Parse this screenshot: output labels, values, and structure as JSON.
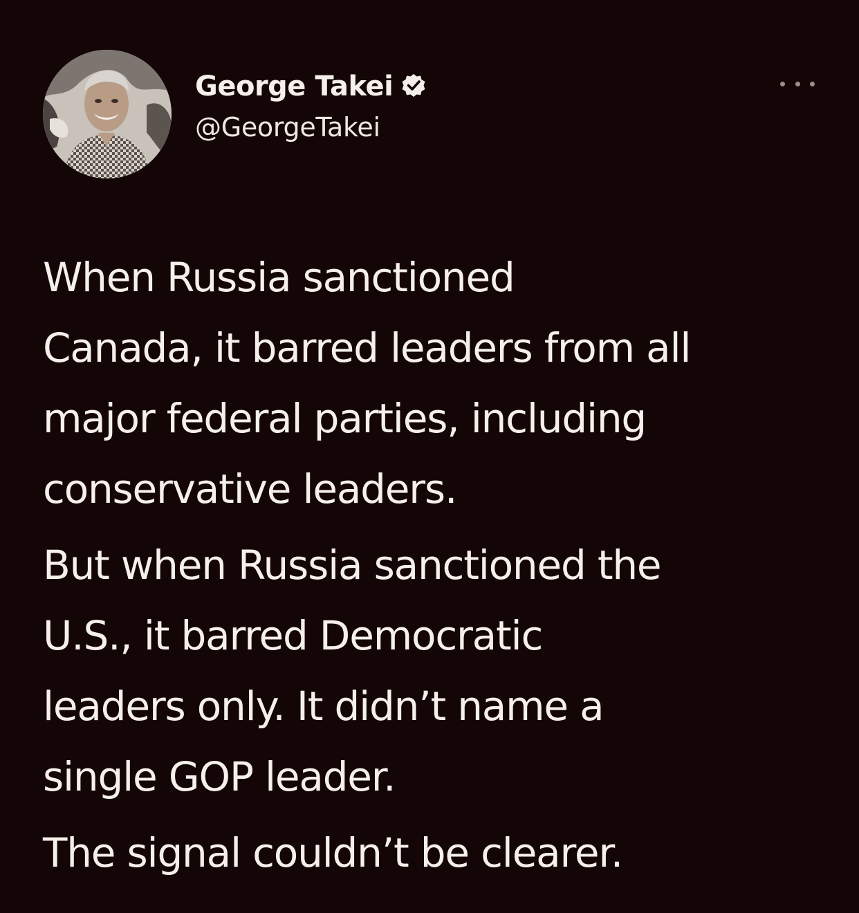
{
  "author": {
    "display_name": "George Takei",
    "handle": "@GeorgeTakei",
    "verified": true,
    "verified_icon": "verified-badge-icon",
    "avatar": "profile-photo"
  },
  "more_icon": "more-options-icon",
  "tweet": {
    "paragraphs": [
      {
        "lines": [
          "When Russia sanctioned",
          "Canada, it barred leaders from all",
          "major federal parties, including",
          "conservative leaders."
        ]
      },
      {
        "lines": [
          "But when Russia sanctioned the",
          "U.S., it barred Democratic",
          "leaders only. It didn’t name a",
          "single GOP leader."
        ]
      },
      {
        "lines": [
          "The signal couldn’t be clearer."
        ]
      }
    ]
  },
  "colors": {
    "background": "#140607",
    "text": "#f6f0ea",
    "muted": "#9b908b"
  }
}
